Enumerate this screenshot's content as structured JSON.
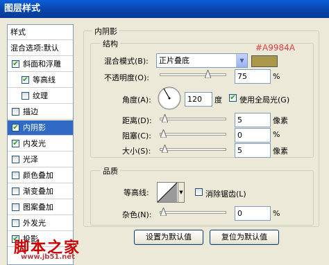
{
  "window": {
    "title": "图层样式"
  },
  "left_panel": {
    "styles_header": "样式",
    "blend_header": "混合选项:默认",
    "items": [
      {
        "label": "斜面和浮雕",
        "checked": true,
        "indent": false,
        "selected": false
      },
      {
        "label": "等高线",
        "checked": true,
        "indent": true,
        "selected": false
      },
      {
        "label": "纹理",
        "checked": false,
        "indent": true,
        "selected": false
      },
      {
        "label": "描边",
        "checked": false,
        "indent": false,
        "selected": false
      },
      {
        "label": "内阴影",
        "checked": true,
        "indent": false,
        "selected": true
      },
      {
        "label": "内发光",
        "checked": true,
        "indent": false,
        "selected": false
      },
      {
        "label": "光泽",
        "checked": false,
        "indent": false,
        "selected": false
      },
      {
        "label": "颜色叠加",
        "checked": false,
        "indent": false,
        "selected": false
      },
      {
        "label": "渐变叠加",
        "checked": false,
        "indent": false,
        "selected": false
      },
      {
        "label": "图案叠加",
        "checked": false,
        "indent": false,
        "selected": false
      },
      {
        "label": "外发光",
        "checked": false,
        "indent": false,
        "selected": false
      },
      {
        "label": "投影",
        "checked": true,
        "indent": false,
        "selected": false
      }
    ]
  },
  "section": {
    "title": "内阴影",
    "structure": {
      "title": "结构",
      "blend_mode_label": "混合模式(B):",
      "blend_mode_value": "正片叠底",
      "color_hex": "#A9984A",
      "color_annotation": "#A9984A",
      "opacity_label": "不透明度(O):",
      "opacity_value": "75",
      "opacity_unit": "%",
      "opacity_level": 0.75,
      "angle_label": "角度(A):",
      "angle_value": "120",
      "angle_unit": "度",
      "global_light_label": "使用全局光(G)",
      "global_light_checked": true,
      "distance_label": "距离(D):",
      "distance_value": "5",
      "distance_unit": "像素",
      "distance_level": 0.02,
      "choke_label": "阻塞(C):",
      "choke_value": "0",
      "choke_unit": "%",
      "choke_level": 0.0,
      "size_label": "大小(S):",
      "size_value": "5",
      "size_unit": "像素",
      "size_level": 0.02
    },
    "quality": {
      "title": "品质",
      "contour_label": "等高线:",
      "anti_alias_label": "消除锯齿(L)",
      "anti_alias_checked": false,
      "noise_label": "杂色(N):",
      "noise_value": "0",
      "noise_unit": "%",
      "noise_level": 0.0
    },
    "buttons": {
      "make_default": "设置为默认值",
      "reset_default": "复位为默认值"
    }
  },
  "watermark": {
    "brand": "脚本之家",
    "url": "www.jb51.net"
  }
}
